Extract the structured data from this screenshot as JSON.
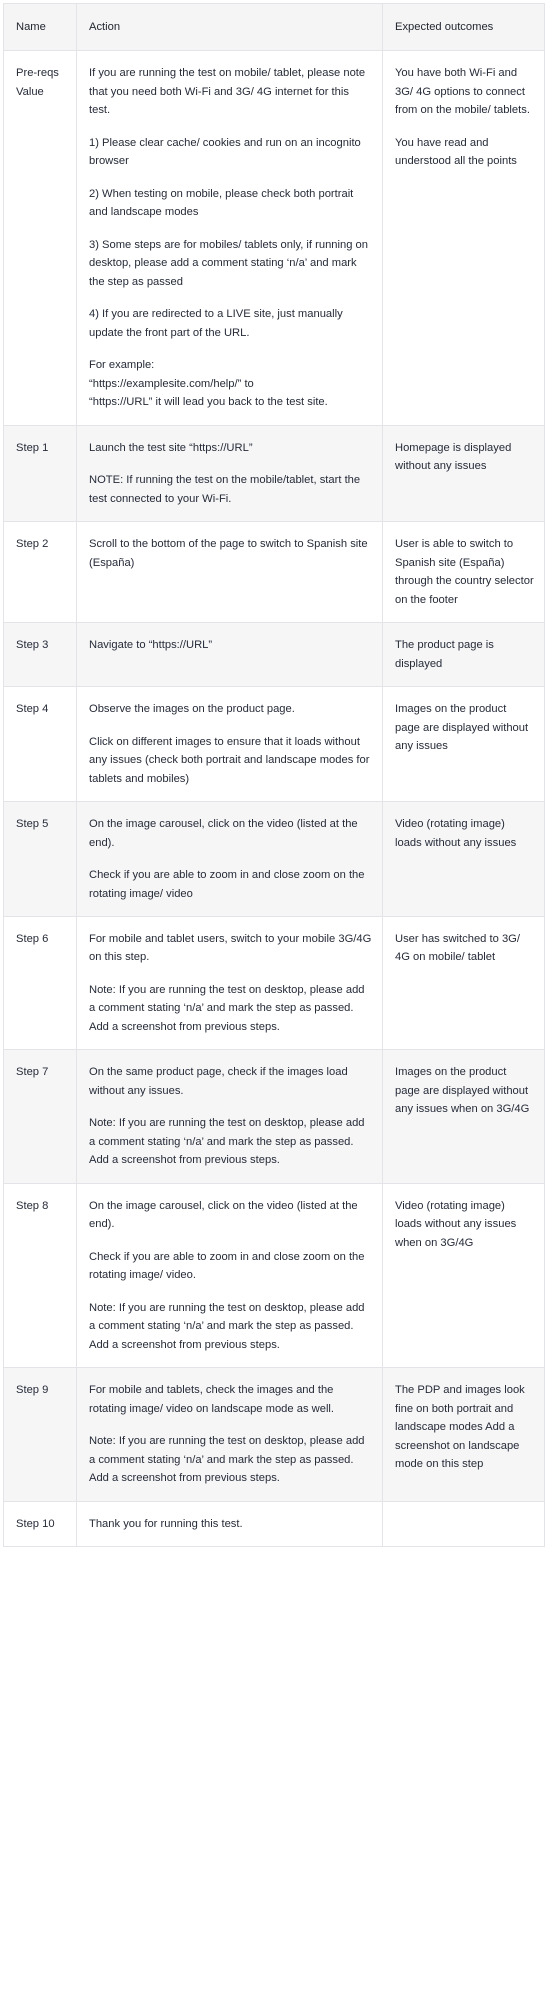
{
  "table": {
    "headers": {
      "name": "Name",
      "action": "Action",
      "expected": "Expected outcomes"
    },
    "rows": [
      {
        "name": "Pre-reqs Value",
        "shaded": false,
        "action_paragraphs": [
          "If you are running the test on mobile/ tablet, please note that you need both Wi-Fi and 3G/ 4G internet for this test.",
          "1) Please clear cache/ cookies and run on an incognito browser",
          "2) When testing on mobile, please check both portrait and landscape modes",
          "3) Some steps are for mobiles/ tablets only, if running on desktop, please add a comment stating ‘n/a’ and mark the step as passed",
          "4) If you are redirected to a LIVE site, just manually update the front part of the URL."
        ],
        "action_example_lines": [
          "For example:",
          "“https://examplesite.com/help/” to",
          "“https://URL” it will lead you back to the test site."
        ],
        "expected_paragraphs": [
          "You have both Wi-Fi and 3G/ 4G options to connect from on the mobile/ tablets.",
          "You have read and understood all the points"
        ]
      },
      {
        "name": "Step 1",
        "shaded": true,
        "action_paragraphs": [
          "Launch the test site “https://URL”",
          "NOTE: If running the test on the mobile/tablet, start the test connected to your Wi-Fi."
        ],
        "expected_paragraphs": [
          "Homepage is displayed without any issues"
        ]
      },
      {
        "name": "Step 2",
        "shaded": false,
        "action_paragraphs": [
          "Scroll to the bottom of the page to switch to Spanish site (España)"
        ],
        "expected_paragraphs": [
          "User is able to switch to Spanish site (España) through the country selector on the footer"
        ]
      },
      {
        "name": "Step 3",
        "shaded": true,
        "action_paragraphs": [
          "Navigate to “https://URL”"
        ],
        "expected_paragraphs": [
          "The product page is displayed"
        ]
      },
      {
        "name": "Step 4",
        "shaded": false,
        "action_paragraphs": [
          "Observe the images on the product page.",
          "Click on different images to ensure that it loads without any issues (check both portrait and landscape modes for tablets and mobiles)"
        ],
        "expected_paragraphs": [
          "Images on the product page are displayed without any issues"
        ]
      },
      {
        "name": "Step 5",
        "shaded": true,
        "action_paragraphs": [
          "On the image carousel, click on the video (listed at the end).",
          "Check if you are able to zoom in and close zoom on the rotating image/ video"
        ],
        "expected_paragraphs": [
          "Video (rotating image) loads without any issues"
        ]
      },
      {
        "name": "Step 6",
        "shaded": false,
        "action_paragraphs": [
          "For mobile and tablet users, switch to your mobile 3G/4G on this step.",
          "Note: If you are running the test on desktop, please add a comment stating ‘n/a’ and mark the step as passed. Add a screenshot from previous steps."
        ],
        "expected_paragraphs": [
          "User has switched to 3G/ 4G on mobile/ tablet"
        ]
      },
      {
        "name": "Step 7",
        "shaded": true,
        "action_paragraphs": [
          "On the same product page, check if the images load without any issues.",
          "Note: If you are running the test on desktop, please add a comment stating ‘n/a’ and mark the step as passed. Add a screenshot from previous steps."
        ],
        "expected_paragraphs": [
          "Images on the product page are displayed without any issues when on 3G/4G"
        ]
      },
      {
        "name": "Step 8",
        "shaded": false,
        "action_paragraphs": [
          "On the image carousel, click on the video (listed at the end).",
          "Check if you are able to zoom in and close zoom on the rotating image/ video.",
          "Note: If you are running the test on desktop, please add a comment stating ‘n/a’ and mark the step as passed. Add a screenshot from previous steps."
        ],
        "expected_paragraphs": [
          "Video (rotating image) loads without any issues when on 3G/4G"
        ]
      },
      {
        "name": "Step 9",
        "shaded": true,
        "action_paragraphs": [
          "For mobile and tablets, check the images and the rotating image/ video on landscape mode as well.",
          "Note: If you are running the test on desktop, please add a comment stating ‘n/a’ and mark the step as passed. Add a screenshot from previous steps."
        ],
        "expected_paragraphs": [
          "The PDP and images look fine on both portrait and landscape modes Add a screenshot on landscape mode on this step"
        ]
      },
      {
        "name": "Step 10",
        "shaded": false,
        "action_paragraphs": [
          "Thank you for running this test."
        ],
        "expected_paragraphs": []
      }
    ]
  }
}
